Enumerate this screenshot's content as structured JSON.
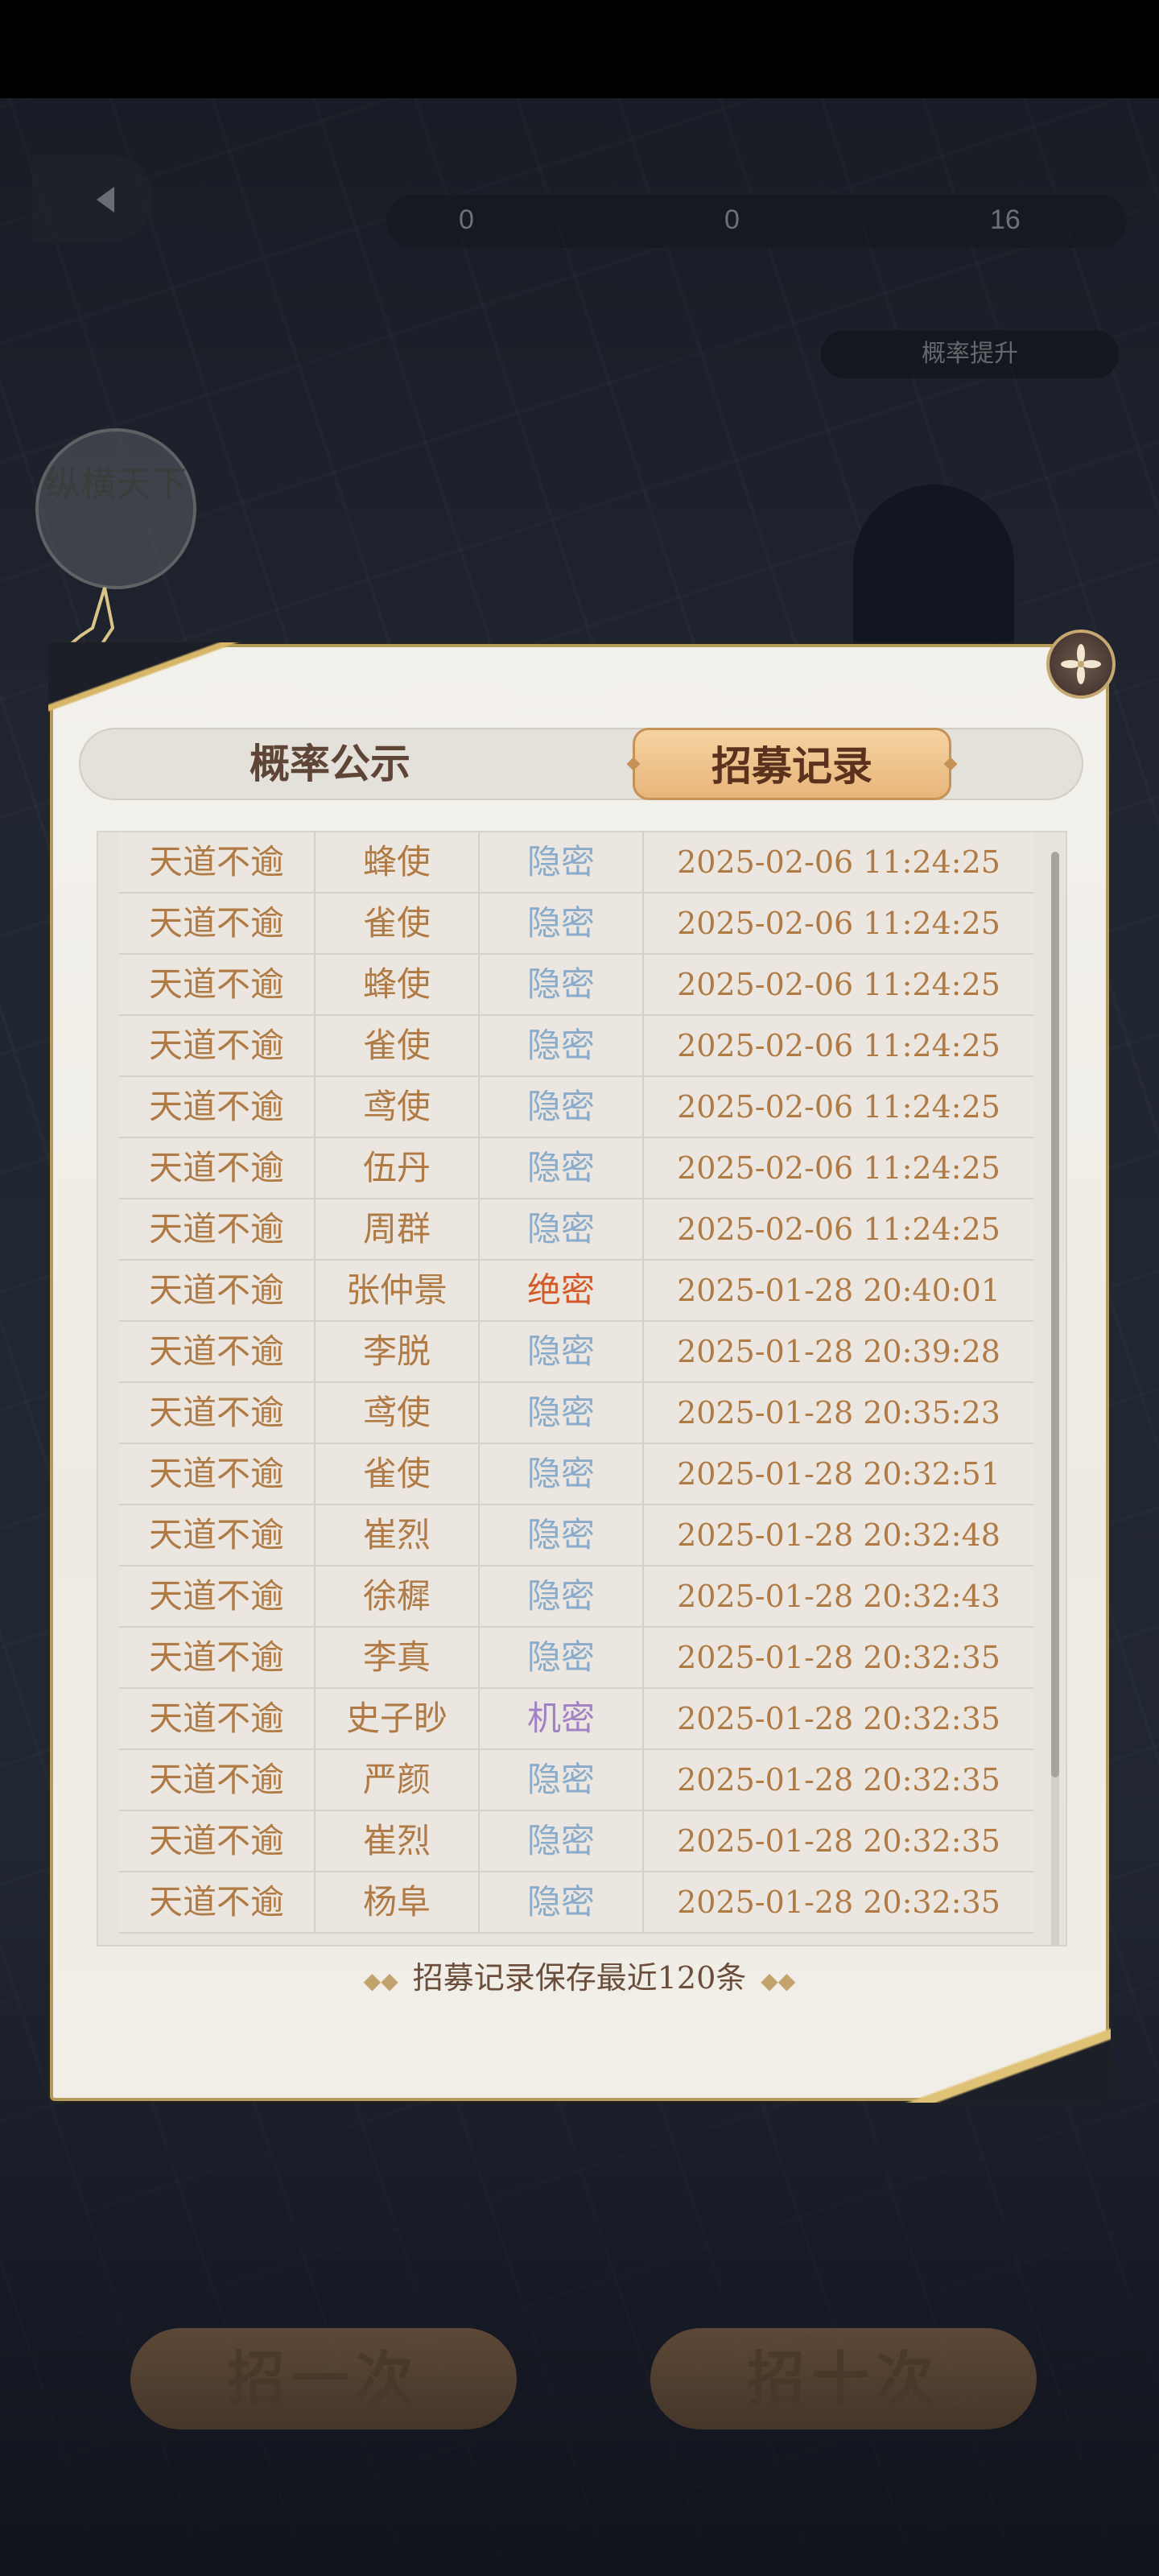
{
  "background": {
    "resource_values": [
      "0",
      "0",
      "16"
    ],
    "prob_link": "概率提升",
    "seal_text": "纵横天下",
    "pull_buttons": [
      "招一次",
      "招十次"
    ]
  },
  "dialog": {
    "tabs": [
      {
        "label": "概率公示",
        "active": false
      },
      {
        "label": "招募记录",
        "active": true
      }
    ],
    "rarity_colors": {
      "隐密": "#8aabc9",
      "绝密": "#d35a2a",
      "机密": "#a282c4"
    },
    "records": [
      {
        "pool": "天道不逾",
        "name": "蜂使",
        "rarity": "隐密",
        "time": "2025-02-06 11:24:25"
      },
      {
        "pool": "天道不逾",
        "name": "雀使",
        "rarity": "隐密",
        "time": "2025-02-06 11:24:25"
      },
      {
        "pool": "天道不逾",
        "name": "蜂使",
        "rarity": "隐密",
        "time": "2025-02-06 11:24:25"
      },
      {
        "pool": "天道不逾",
        "name": "雀使",
        "rarity": "隐密",
        "time": "2025-02-06 11:24:25"
      },
      {
        "pool": "天道不逾",
        "name": "鸢使",
        "rarity": "隐密",
        "time": "2025-02-06 11:24:25"
      },
      {
        "pool": "天道不逾",
        "name": "伍丹",
        "rarity": "隐密",
        "time": "2025-02-06 11:24:25"
      },
      {
        "pool": "天道不逾",
        "name": "周群",
        "rarity": "隐密",
        "time": "2025-02-06 11:24:25"
      },
      {
        "pool": "天道不逾",
        "name": "张仲景",
        "rarity": "绝密",
        "time": "2025-01-28 20:40:01"
      },
      {
        "pool": "天道不逾",
        "name": "李脱",
        "rarity": "隐密",
        "time": "2025-01-28 20:39:28"
      },
      {
        "pool": "天道不逾",
        "name": "鸢使",
        "rarity": "隐密",
        "time": "2025-01-28 20:35:23"
      },
      {
        "pool": "天道不逾",
        "name": "雀使",
        "rarity": "隐密",
        "time": "2025-01-28 20:32:51"
      },
      {
        "pool": "天道不逾",
        "name": "崔烈",
        "rarity": "隐密",
        "time": "2025-01-28 20:32:48"
      },
      {
        "pool": "天道不逾",
        "name": "徐穉",
        "rarity": "隐密",
        "time": "2025-01-28 20:32:43"
      },
      {
        "pool": "天道不逾",
        "name": "李真",
        "rarity": "隐密",
        "time": "2025-01-28 20:32:35"
      },
      {
        "pool": "天道不逾",
        "name": "史子眇",
        "rarity": "机密",
        "time": "2025-01-28 20:32:35"
      },
      {
        "pool": "天道不逾",
        "name": "严颜",
        "rarity": "隐密",
        "time": "2025-01-28 20:32:35"
      },
      {
        "pool": "天道不逾",
        "name": "崔烈",
        "rarity": "隐密",
        "time": "2025-01-28 20:32:35"
      },
      {
        "pool": "天道不逾",
        "name": "杨阜",
        "rarity": "隐密",
        "time": "2025-01-28 20:32:35"
      }
    ],
    "footer_note": "招募记录保存最近120条"
  }
}
